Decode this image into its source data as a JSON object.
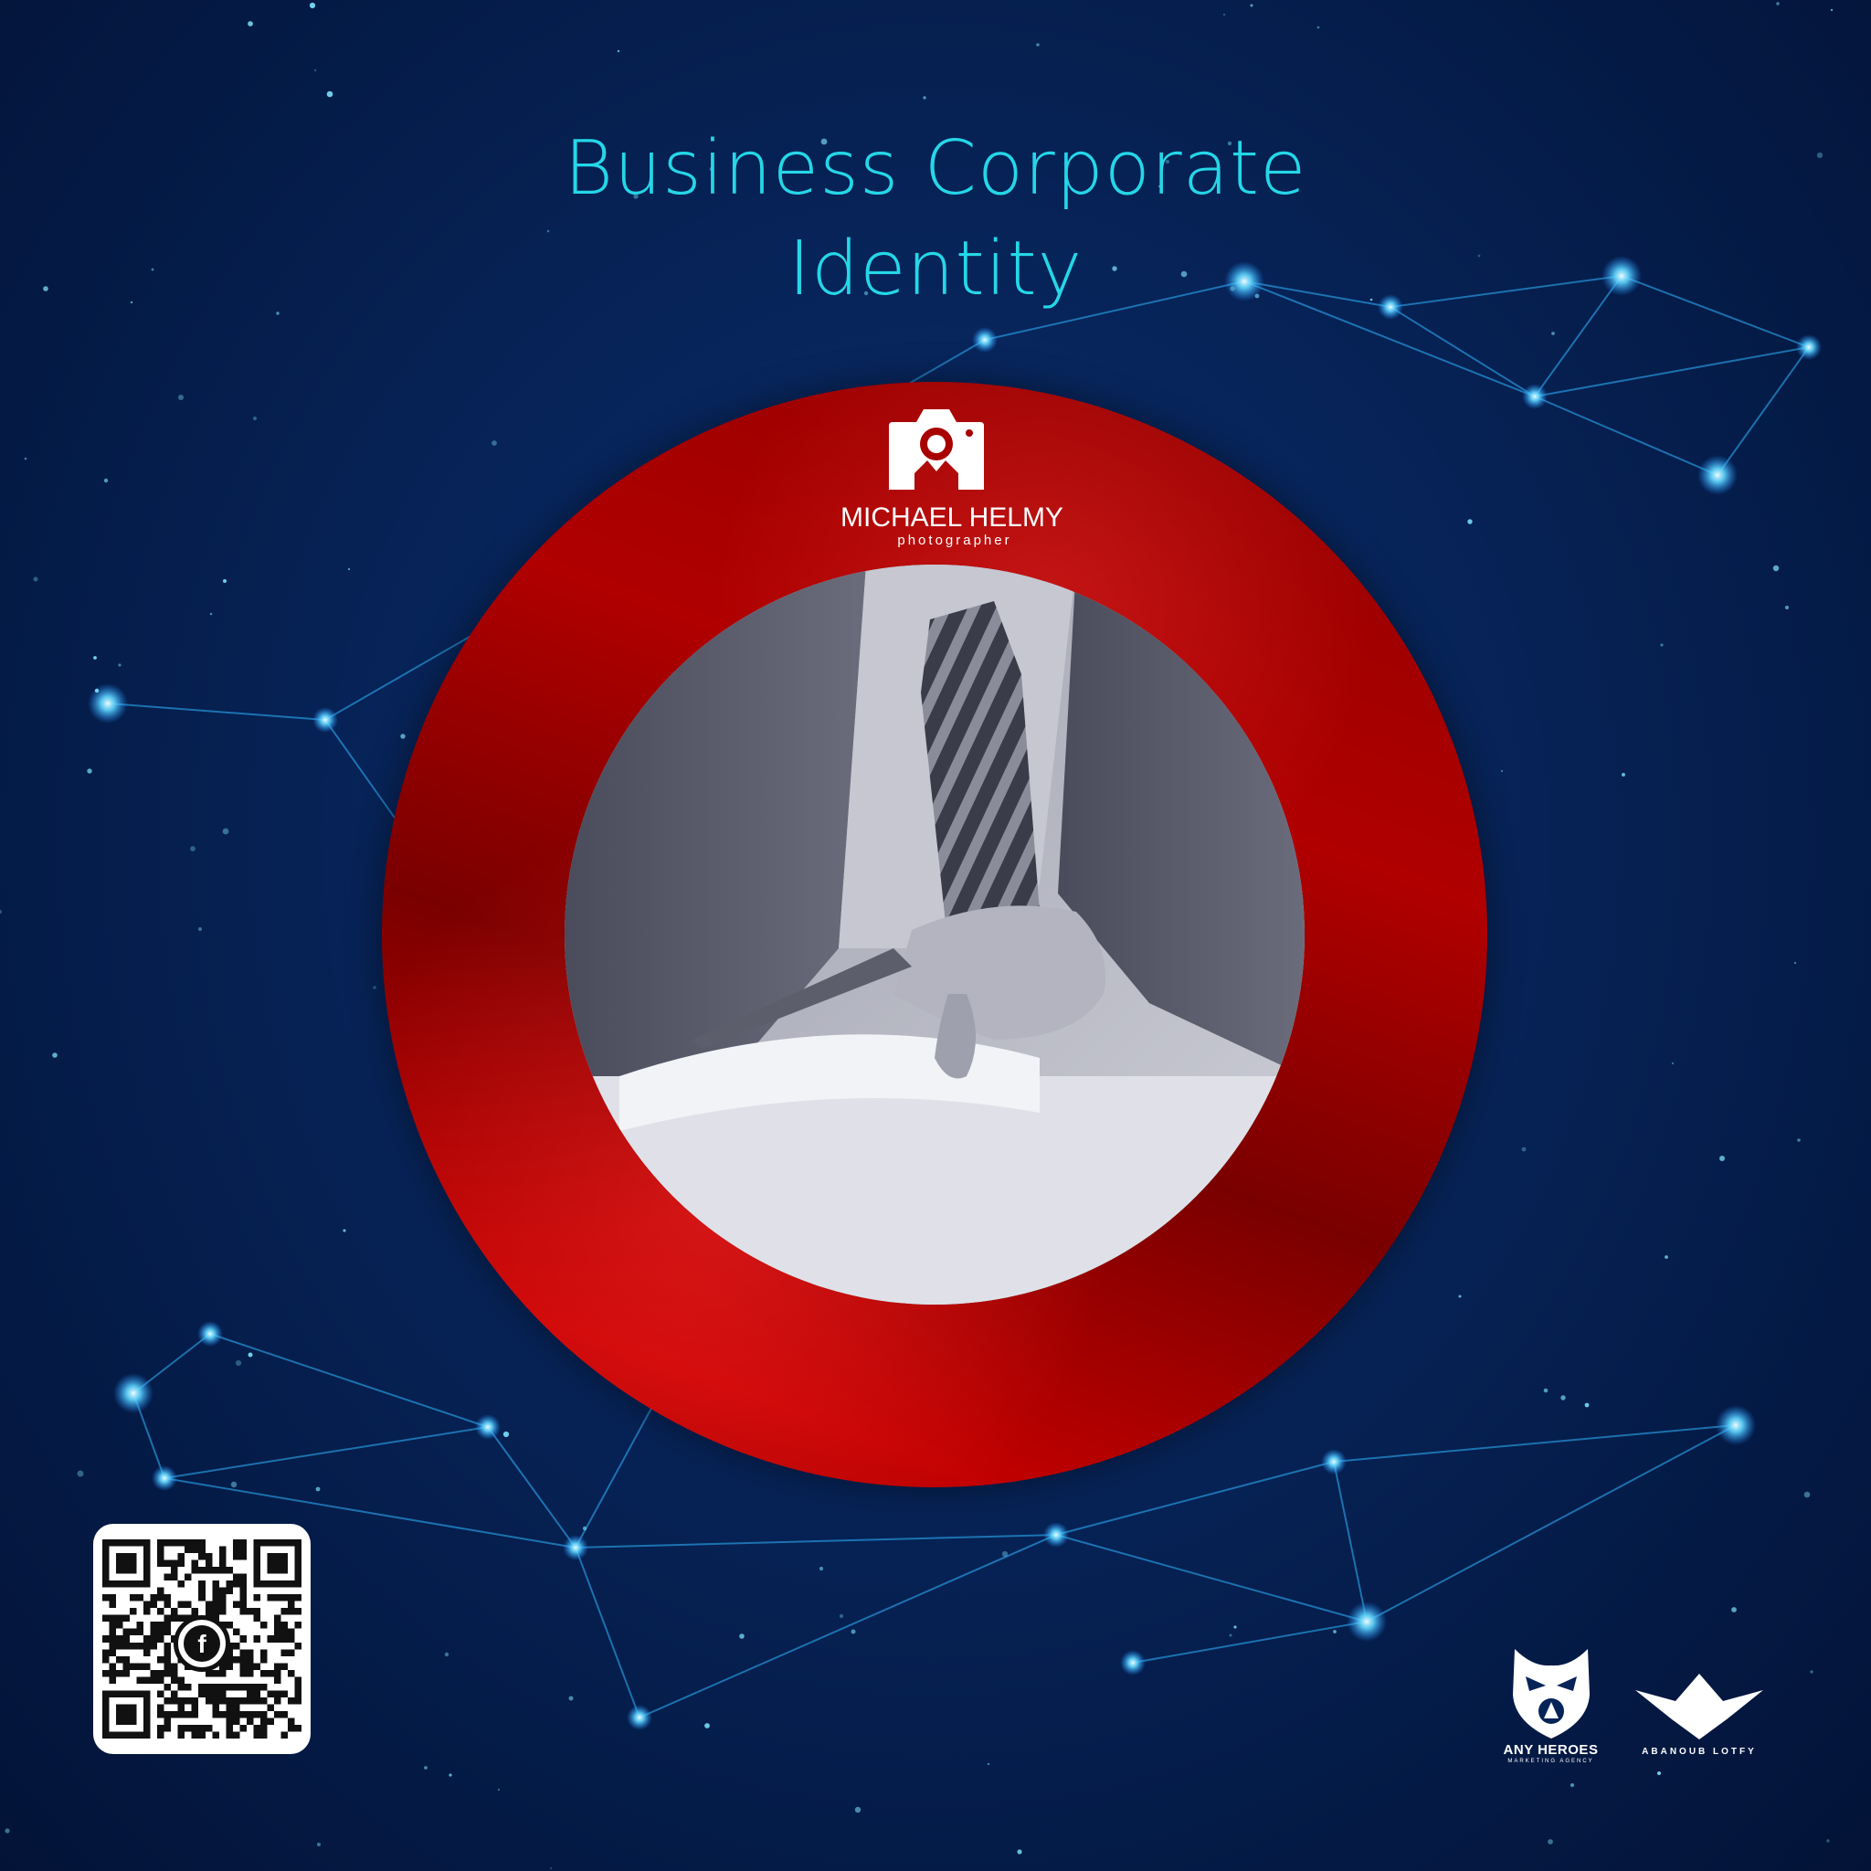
{
  "headline": {
    "line1": "Business Corporate",
    "line2": "Identity"
  },
  "photographer_logo": {
    "name": "MICHAEL HELMY",
    "role": "photographer",
    "icon": "camera-icon"
  },
  "qr": {
    "icon": "facebook-icon",
    "badge": "f"
  },
  "agency_logo": {
    "name": "ANY HEROES",
    "tagline": "MARKETING AGENCY"
  },
  "designer_logo": {
    "name": "ABANOUB LOTFY"
  },
  "colors": {
    "background": "#072459",
    "headline": "#25d7e8",
    "ring": "#b00000",
    "node": "#4fd8ff"
  }
}
